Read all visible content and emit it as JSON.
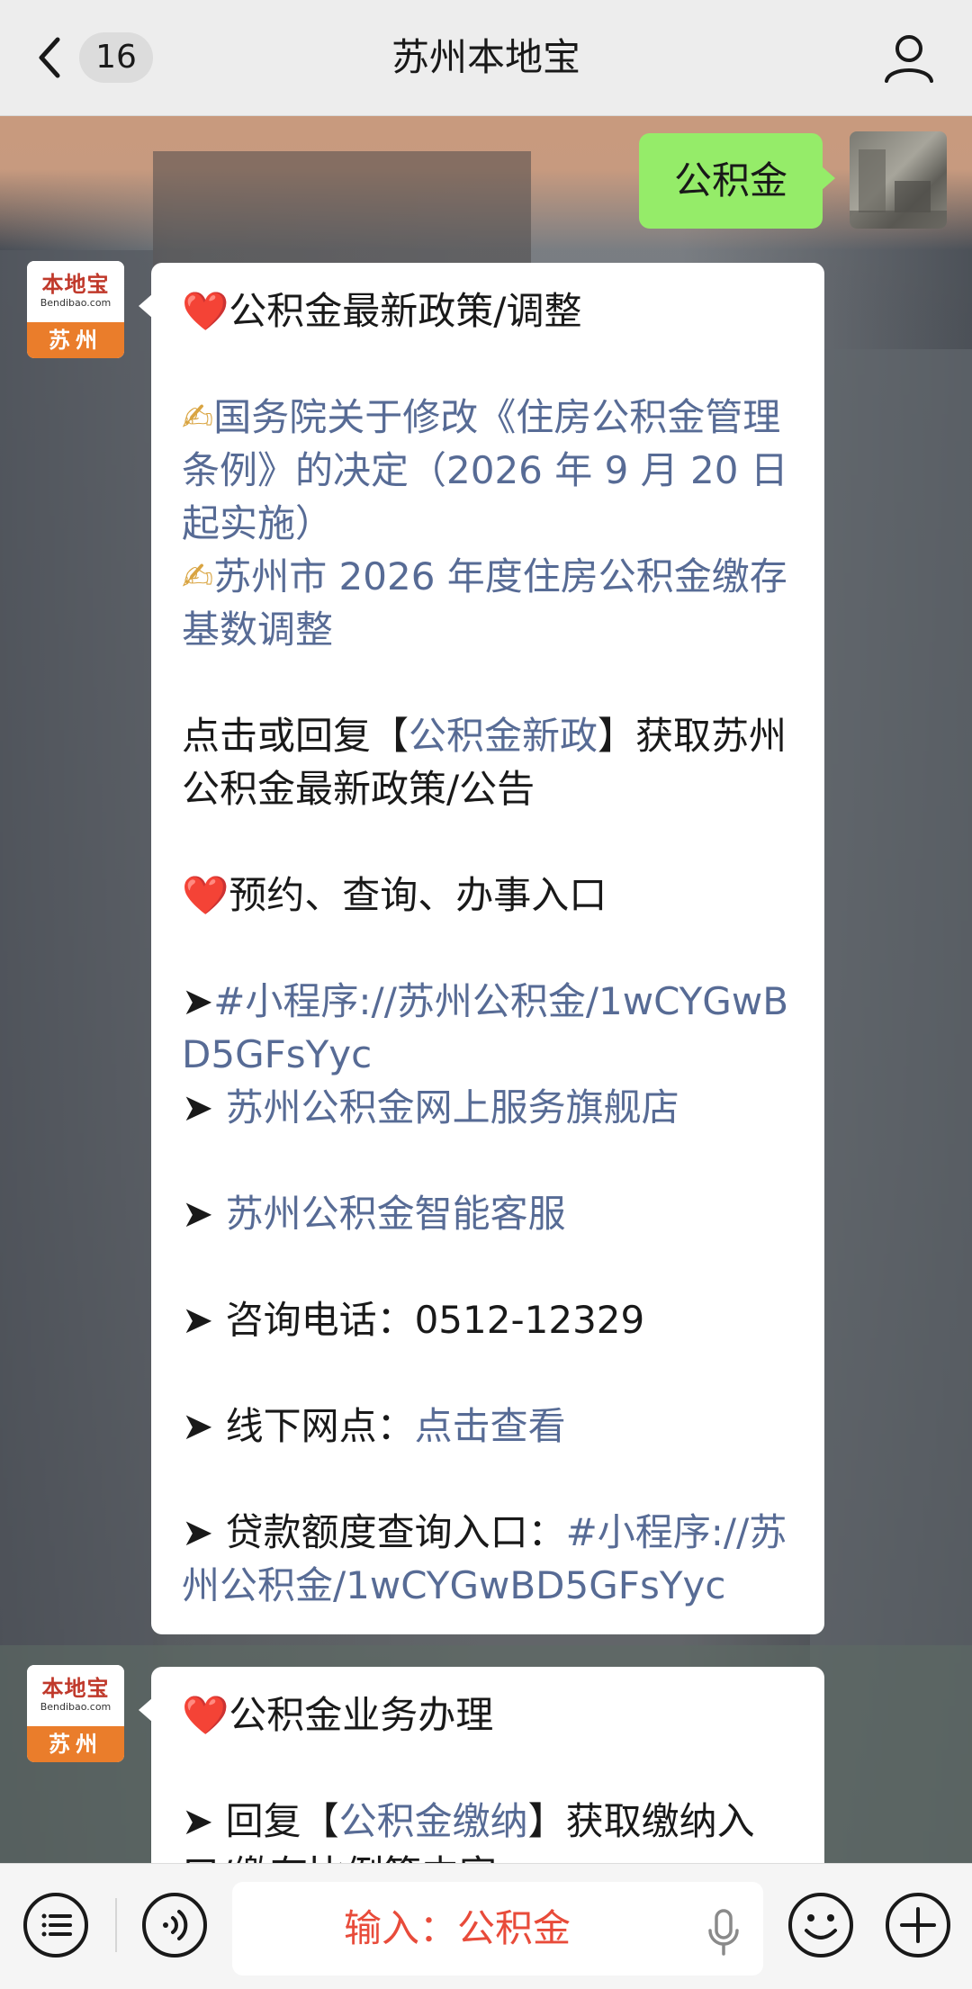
{
  "header": {
    "unread_count": "16",
    "title": "苏州本地宝"
  },
  "self_message": {
    "text": "公积金"
  },
  "bot_avatar": {
    "logo_text": "本地宝",
    "logo_domain": "Bendibao.com",
    "city": "苏州"
  },
  "message1": {
    "heart1": "❤️",
    "heading1": "公积金最新政策/调整",
    "pen": "✍",
    "item1": "国务院关于修改《住房公积金管理条例》的决定（2026 年 9 月 20 日起实施）",
    "item2": "苏州市 2026 年度住房公积金缴存基数调整",
    "reply_prefix": "点击或回复【",
    "reply_link": "公积金新政",
    "reply_suffix": "】获取苏州公积金最新政策/公告",
    "heading2": "预约、查询、办事入口",
    "arrow": "➤",
    "mini_program": "#小程序://苏州公积金/1wCYGwBD5GFsYyc",
    "flagship_store": "苏州公积金网上服务旗舰店",
    "smart_service": "苏州公积金智能客服",
    "phone_label": "咨询电话：",
    "phone_number": "0512-12329",
    "outlet_label": "线下网点：",
    "outlet_link": "点击查看",
    "loan_label": "贷款额度查询入口：",
    "loan_link": "#小程序://苏州公积金/1wCYGwBD5GFsYyc"
  },
  "message2": {
    "heading": "公积金业务办理",
    "reply_prefix": "回复【",
    "reply_link": "公积金缴纳",
    "reply_suffix": "】获取缴纳入口/缴存比例等内容"
  },
  "input_bar": {
    "input_text": "输入：公积金"
  },
  "colors": {
    "link": "#576b95",
    "self_bubble": "#95ec69",
    "input_hint": "#e84b3a"
  }
}
